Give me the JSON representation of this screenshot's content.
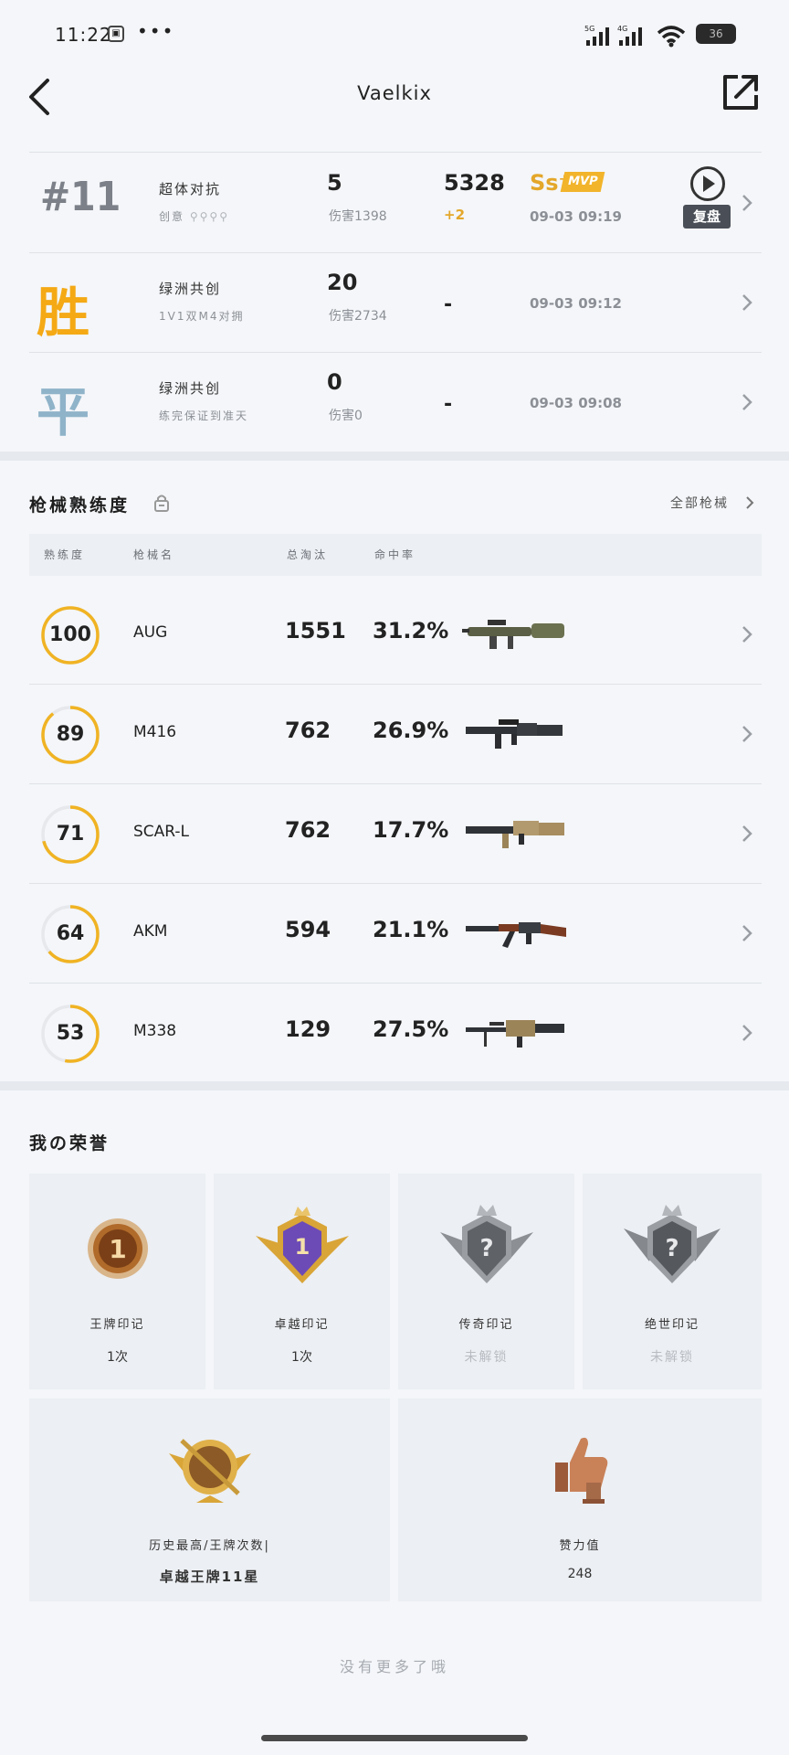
{
  "status_bar": {
    "time": "11:22",
    "notif_icon_text": "lǎ",
    "dots": "•••",
    "net1": "5G",
    "net2": "4G",
    "battery": "36"
  },
  "header": {
    "title": "Vaelkix"
  },
  "matches": [
    {
      "badge": "#11",
      "badge_type": "rank",
      "mode": "超体对抗",
      "sub": "创意",
      "kills": "5",
      "damage": "伤害1398",
      "score": "5328",
      "delta": "+2",
      "grade": "Ss⁺",
      "mvp": "MVP",
      "date": "09-03 09:19",
      "replay": "复盘"
    },
    {
      "badge": "胜",
      "badge_type": "win",
      "mode": "绿洲共创",
      "sub": "1V1双M4对拥",
      "kills": "20",
      "damage": "伤害2734",
      "score": "-",
      "date": "09-03 09:12"
    },
    {
      "badge": "平",
      "badge_type": "draw",
      "mode": "绿洲共创",
      "sub": "练完保证到准天",
      "kills": "0",
      "damage": "伤害0",
      "score": "-",
      "date": "09-03 09:08"
    }
  ],
  "weapons_section": {
    "title": "枪械熟练度",
    "all_link": "全部枪械",
    "headers": {
      "proficiency": "熟练度",
      "name": "枪械名",
      "kills": "总淘汰",
      "accuracy": "命中率"
    },
    "rows": [
      {
        "proficiency": "100",
        "level": 1.0,
        "name": "AUG",
        "kills": "1551",
        "accuracy": "31.2%",
        "gun_icon": "aug-rifle-icon"
      },
      {
        "proficiency": "89",
        "level": 0.89,
        "name": "M416",
        "kills": "762",
        "accuracy": "26.9%",
        "gun_icon": "m416-rifle-icon"
      },
      {
        "proficiency": "71",
        "level": 0.71,
        "name": "SCAR-L",
        "kills": "762",
        "accuracy": "17.7%",
        "gun_icon": "scar-rifle-icon"
      },
      {
        "proficiency": "64",
        "level": 0.64,
        "name": "AKM",
        "kills": "594",
        "accuracy": "21.1%",
        "gun_icon": "akm-rifle-icon"
      },
      {
        "proficiency": "53",
        "level": 0.53,
        "name": "M338",
        "kills": "129",
        "accuracy": "27.5%",
        "gun_icon": "m338-gun-icon"
      }
    ]
  },
  "honors_section": {
    "title": "我の荣誉",
    "cards": [
      {
        "name": "王牌印记",
        "value": "1次",
        "emblem_number": "1",
        "locked": false
      },
      {
        "name": "卓越印记",
        "value": "1次",
        "emblem_number": "1",
        "locked": false
      },
      {
        "name": "传奇印记",
        "value": "未解锁",
        "emblem_number": "?",
        "locked": true
      },
      {
        "name": "绝世印记",
        "value": "未解锁",
        "emblem_number": "?",
        "locked": true
      }
    ],
    "wide_cards": [
      {
        "name": "历史最高/王牌次数|",
        "value": "卓越王牌11星"
      },
      {
        "name": "赞力值",
        "value": "248"
      }
    ]
  },
  "footer": {
    "text": "没有更多了哦"
  },
  "colors": {
    "accent": "#f0b323",
    "ring_track": "#e6e8ec",
    "win": "#f4a915",
    "draw": "#8fb3c9"
  }
}
